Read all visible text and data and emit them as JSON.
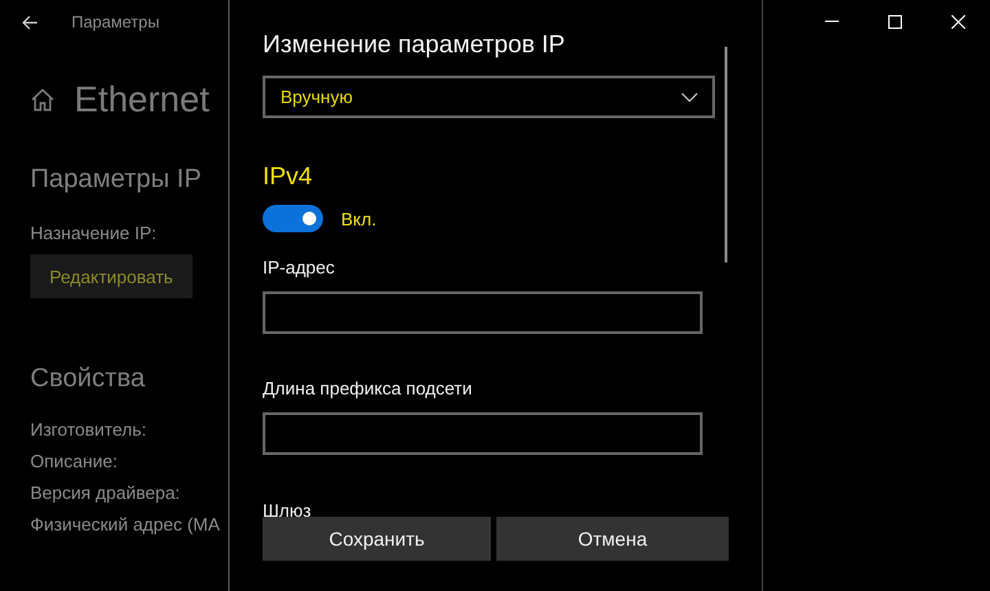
{
  "window": {
    "title": "Параметры"
  },
  "page": {
    "title": "Ethernet"
  },
  "ip_settings": {
    "heading": "Параметры IP",
    "assignment_label": "Назначение IP:",
    "edit_button": "Редактировать"
  },
  "properties": {
    "heading": "Свойства",
    "items": [
      "Изготовитель:",
      "Описание:",
      "Версия драйвера:",
      "Физический адрес (MA"
    ]
  },
  "dialog": {
    "title": "Изменение параметров IP",
    "mode": {
      "value": "Вручную"
    },
    "ipv4": {
      "heading": "IPv4",
      "toggle": {
        "on": true,
        "label": "Вкл."
      }
    },
    "fields": [
      {
        "label": "IP-адрес"
      },
      {
        "label": "Длина префикса подсети"
      }
    ],
    "partial_label": "Шлюз",
    "buttons": [
      {
        "label": "Сохранить"
      },
      {
        "label": "Отмена"
      }
    ]
  }
}
